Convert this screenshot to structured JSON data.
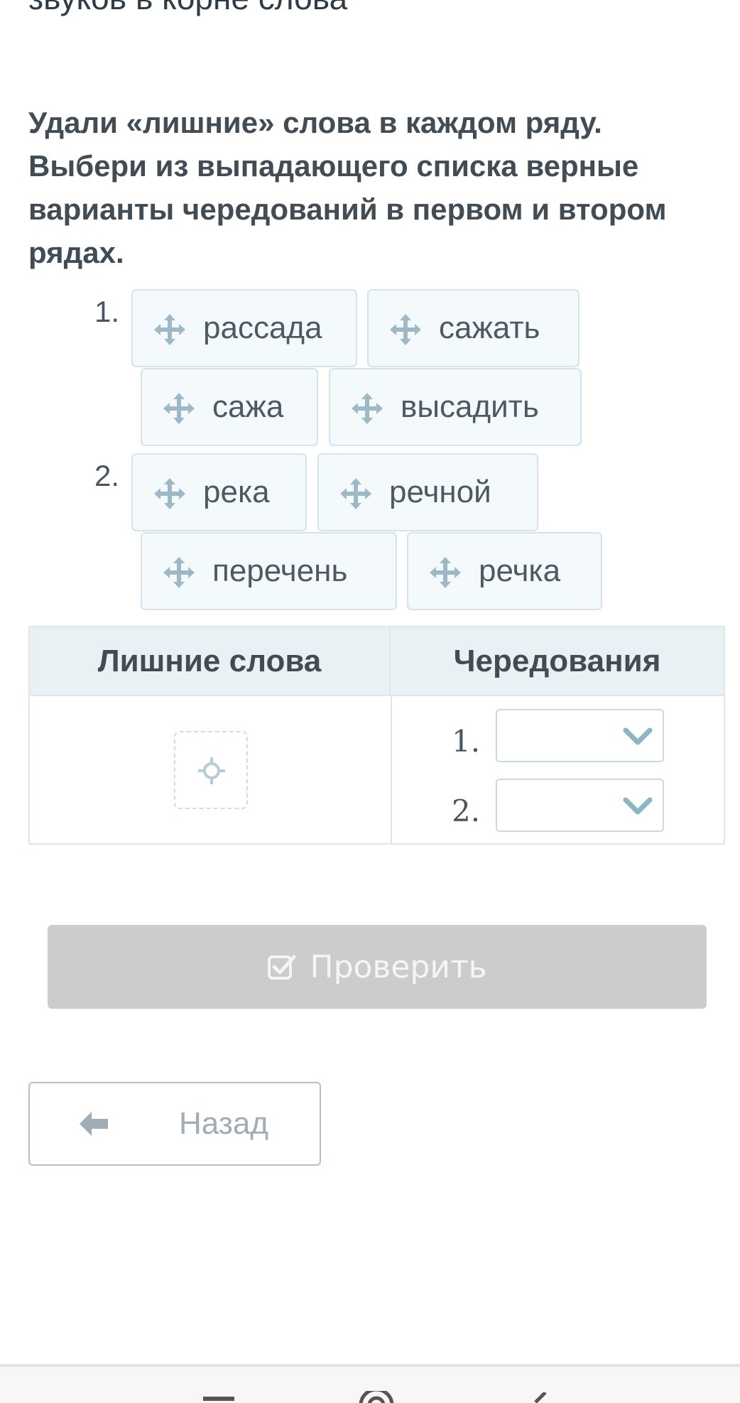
{
  "page": {
    "heading_fragment": "звуков в корне слова",
    "instructions": "Удали «лишние» слова в каждом ряду. Выбери из выпадающего списка верные варианты чередований в первом и втором рядах."
  },
  "rows": [
    {
      "number": "1.",
      "words": [
        "рассада",
        "сажать",
        "сажа",
        "высадить"
      ]
    },
    {
      "number": "2.",
      "words": [
        "река",
        "речной",
        "перечень",
        "речка"
      ]
    }
  ],
  "table": {
    "col_extra_words": "Лишние слова",
    "col_alternations": "Чередования",
    "selects": [
      {
        "number": "1.",
        "value": ""
      },
      {
        "number": "2.",
        "value": ""
      }
    ]
  },
  "buttons": {
    "check_label": "Проверить",
    "back_label": "Назад"
  },
  "colors": {
    "chip_bg": "#f4f9fc",
    "chip_border": "#d4e3ec",
    "check_btn_bg": "#cccccc",
    "header_bg": "#e9f1f5",
    "chevron": "#8bb6c4"
  },
  "icons": [
    "move-icon",
    "drop-target-icon",
    "chevron-down-icon",
    "checkbox-icon",
    "arrow-left-icon"
  ]
}
